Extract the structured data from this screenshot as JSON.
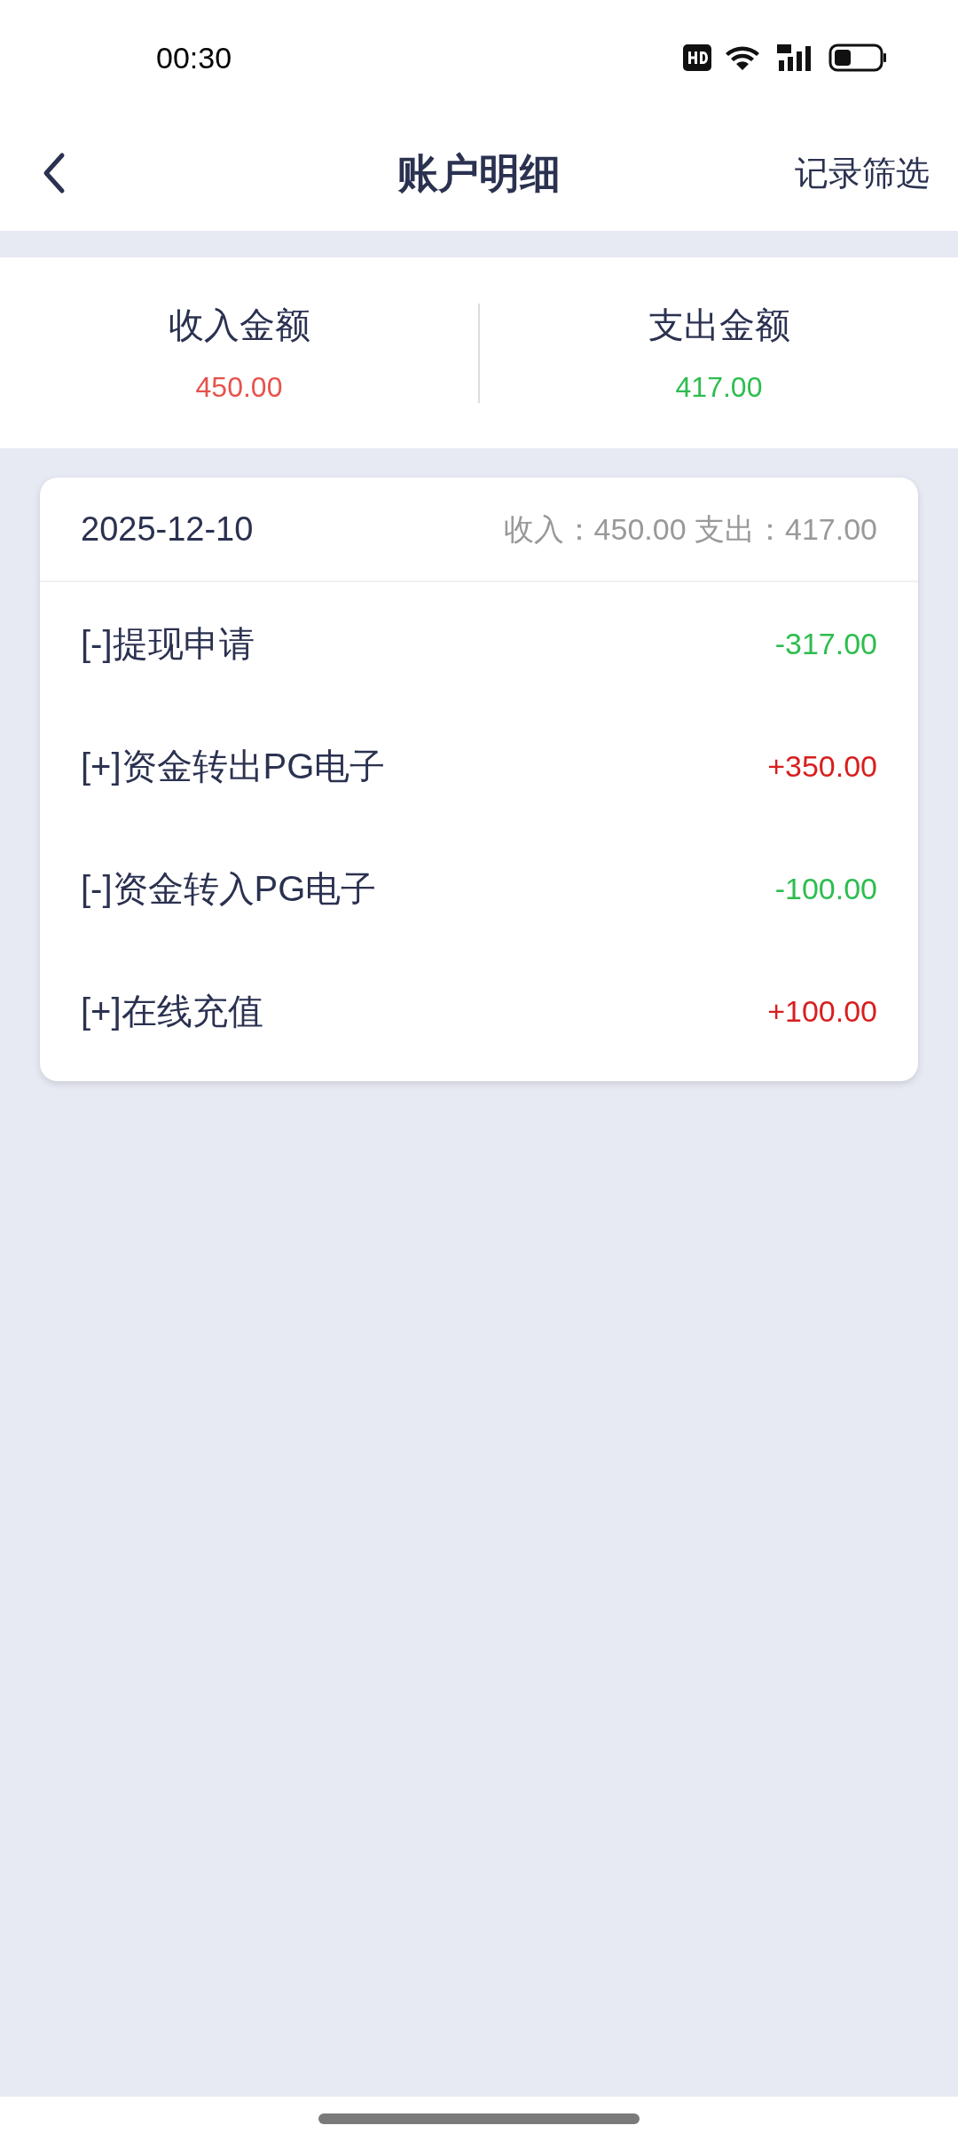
{
  "status_bar": {
    "time": "00:30"
  },
  "header": {
    "title": "账户明细",
    "action": "记录筛选"
  },
  "summary": [
    {
      "label": "收入金额",
      "amount": "450.00",
      "kind": "income"
    },
    {
      "label": "支出金额",
      "amount": "417.00",
      "kind": "expense"
    }
  ],
  "day": {
    "date": "2025-12-10",
    "totals": "收入：450.00 支出：417.00",
    "records": [
      {
        "label": "[-]提现申请",
        "amount": "-317.00",
        "kind": "expense"
      },
      {
        "label": "[+]资金转出PG电子",
        "amount": "+350.00",
        "kind": "income"
      },
      {
        "label": "[-]资金转入PG电子",
        "amount": "-100.00",
        "kind": "expense"
      },
      {
        "label": "[+]在线充值",
        "amount": "+100.00",
        "kind": "income"
      }
    ]
  }
}
